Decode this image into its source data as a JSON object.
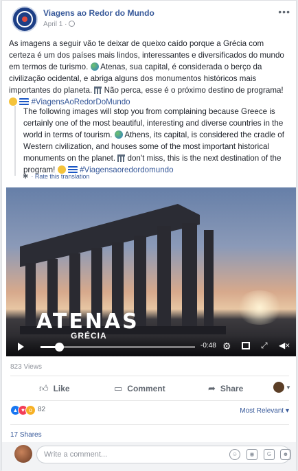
{
  "post": {
    "page_name": "Viagens ao Redor do Mundo",
    "date": "April 1 ·",
    "more_label": "•••",
    "text_pt_1": "As imagens a seguir vão te deixar de queixo caído porque a Grécia com certeza é um dos países mais lindos, interessantes e diversificados do mundo em termos de turismo.",
    "text_pt_2": "Atenas, sua capital, é considerada o berço da civilização ocidental, e abriga alguns dos monumentos históricos mais importantes do planeta.",
    "text_pt_3": "Não perca, esse é o próximo destino de programa!",
    "hashtag_pt": "#ViagensAoRedorDoMundo",
    "text_en_1": "The following images will stop you from complaining because Greece is certainly one of the most beautiful, interesting and diverse countries in the world in terms of tourism.",
    "text_en_2": "Athens, its capital, is considered the cradle of Western civilization, and houses some of the most important historical monuments on the planet.",
    "text_en_3": "don't miss, this is the next destination of the program!",
    "hashtag_en": "#Viagensaoredordomundo",
    "rate_translation": "· Rate this translation"
  },
  "video": {
    "title": "ATENAS",
    "subtitle": "GRÉCIA",
    "time_remaining": "-0:48",
    "progress_fraction": 0.12
  },
  "stats": {
    "views": "823 Views",
    "reaction_count": "82",
    "sort_label": "Most Relevant ▾",
    "shares": "17 Shares"
  },
  "actions": {
    "like": "Like",
    "comment": "Comment",
    "share": "Share"
  },
  "comment_box": {
    "placeholder": "Write a comment..."
  },
  "icons": {
    "globe": "globe-icon",
    "temple": "temple-icon",
    "settings": "gear-icon"
  }
}
